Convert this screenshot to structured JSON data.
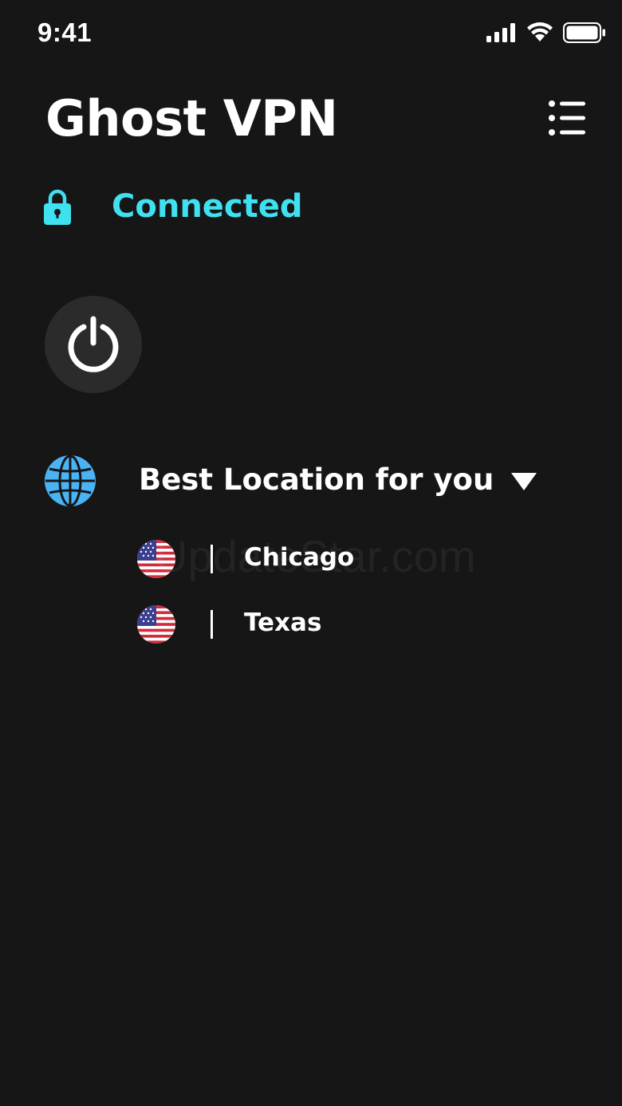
{
  "status_bar": {
    "time": "9:41"
  },
  "header": {
    "title": "Ghost VPN"
  },
  "connection": {
    "status_text": "Connected",
    "color": "#3fe0f0"
  },
  "location": {
    "label": "Best Location for you",
    "servers": [
      {
        "name": "Chicago",
        "flag": "us-flag-icon"
      },
      {
        "name": "Texas",
        "flag": "us-flag-icon"
      }
    ]
  },
  "watermark": "UpdateStar.com"
}
